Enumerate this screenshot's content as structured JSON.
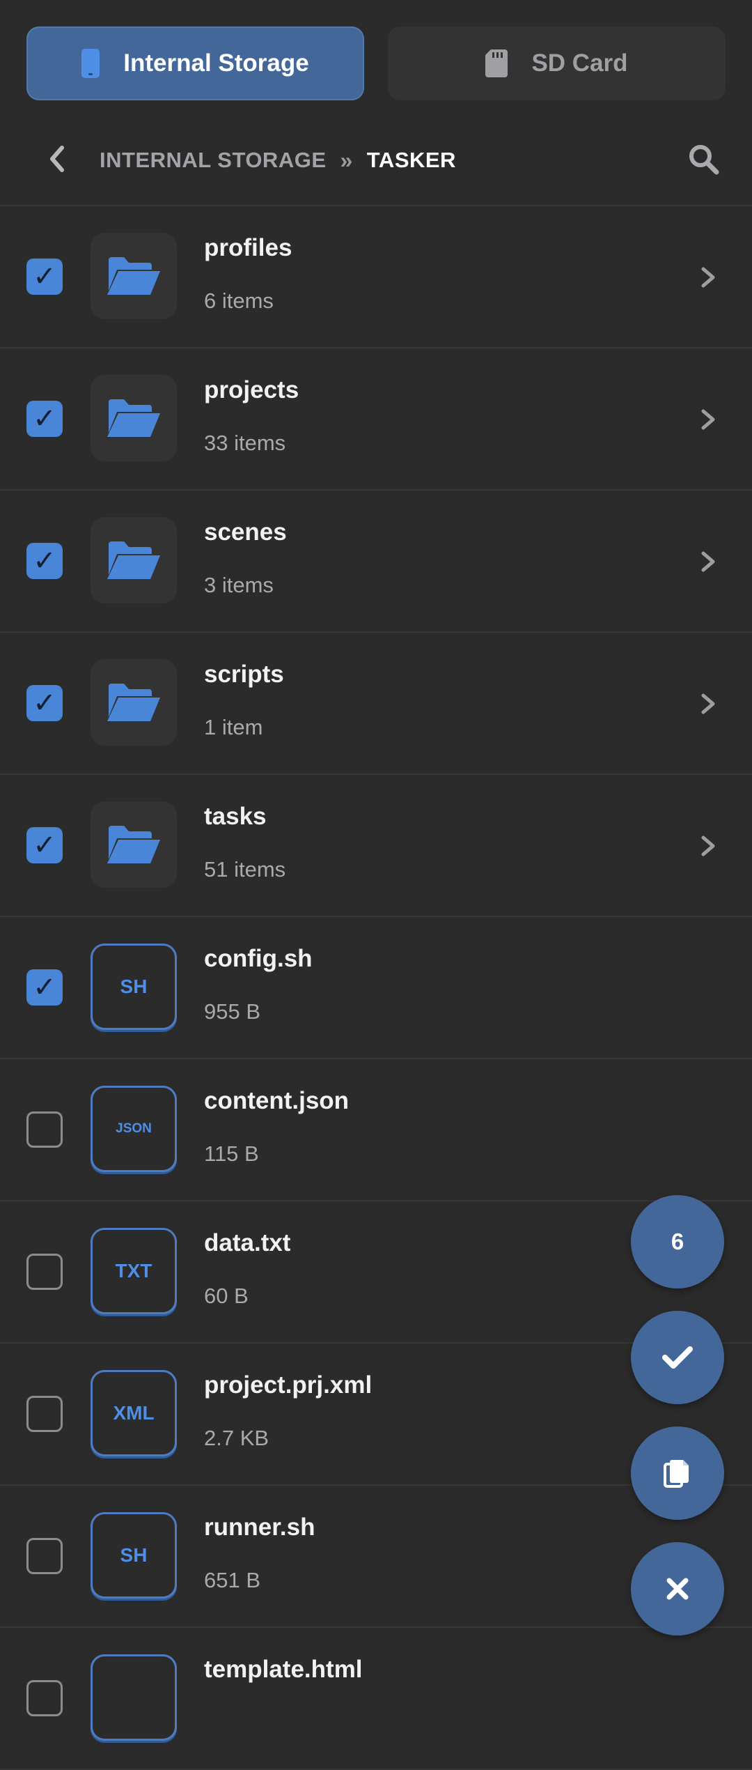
{
  "storage_tabs": {
    "internal": {
      "label": "Internal Storage",
      "icon": "phone-icon",
      "active": true
    },
    "sd": {
      "label": "SD Card",
      "icon": "sd-card-icon",
      "active": false
    }
  },
  "breadcrumb": {
    "root": "INTERNAL STORAGE",
    "separator": "»",
    "current": "TASKER"
  },
  "items": [
    {
      "kind": "folder",
      "name": "profiles",
      "meta": "6 items",
      "checked": true
    },
    {
      "kind": "folder",
      "name": "projects",
      "meta": "33 items",
      "checked": true
    },
    {
      "kind": "folder",
      "name": "scenes",
      "meta": "3 items",
      "checked": true
    },
    {
      "kind": "folder",
      "name": "scripts",
      "meta": "1 item",
      "checked": true
    },
    {
      "kind": "folder",
      "name": "tasks",
      "meta": "51 items",
      "checked": true
    },
    {
      "kind": "file",
      "name": "config.sh",
      "meta": "955 B",
      "type_label": "SH",
      "checked": true
    },
    {
      "kind": "file",
      "name": "content.json",
      "meta": "115 B",
      "type_label": "JSON",
      "checked": false
    },
    {
      "kind": "file",
      "name": "data.txt",
      "meta": "60 B",
      "type_label": "TXT",
      "checked": false
    },
    {
      "kind": "file",
      "name": "project.prj.xml",
      "meta": "2.7 KB",
      "type_label": "XML",
      "checked": false
    },
    {
      "kind": "file",
      "name": "runner.sh",
      "meta": "651 B",
      "type_label": "SH",
      "checked": false
    },
    {
      "kind": "file",
      "name": "template.html",
      "meta": "",
      "type_label": "",
      "checked": false
    }
  ],
  "check_glyph": "✓",
  "fabs": {
    "selected_count": "6",
    "confirm_icon": "check-icon",
    "copy_icon": "copy-icon",
    "close_icon": "close-icon"
  },
  "colors": {
    "background": "#2b2b2b",
    "accent": "#44679a",
    "checkbox": "#4a86d8",
    "file_label": "#4f8fe6"
  }
}
